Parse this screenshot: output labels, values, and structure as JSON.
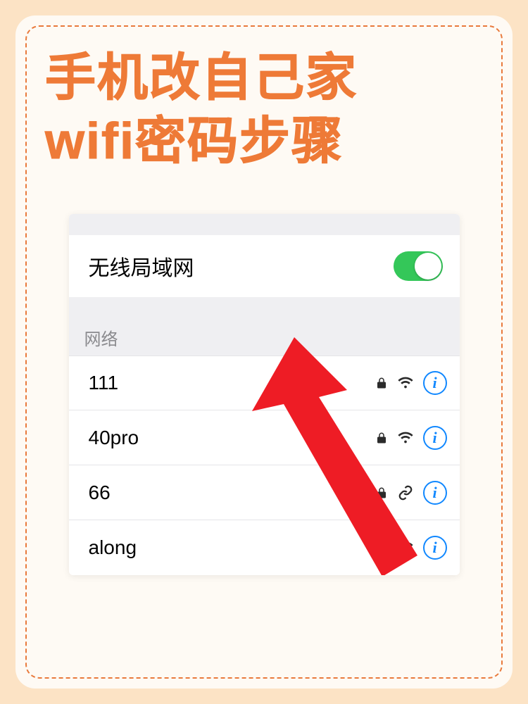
{
  "title_line1": "手机改自己家",
  "title_line2": "wifi密码步骤",
  "wifi": {
    "toggle_label": "无线局域网",
    "section_header": "网络",
    "networks": [
      {
        "name": "111",
        "secured": true,
        "signal": "wifi"
      },
      {
        "name": "40pro",
        "secured": true,
        "signal": "wifi"
      },
      {
        "name": "66",
        "secured": true,
        "signal": "link"
      },
      {
        "name": "along",
        "secured": true,
        "signal": "wifi"
      }
    ]
  }
}
